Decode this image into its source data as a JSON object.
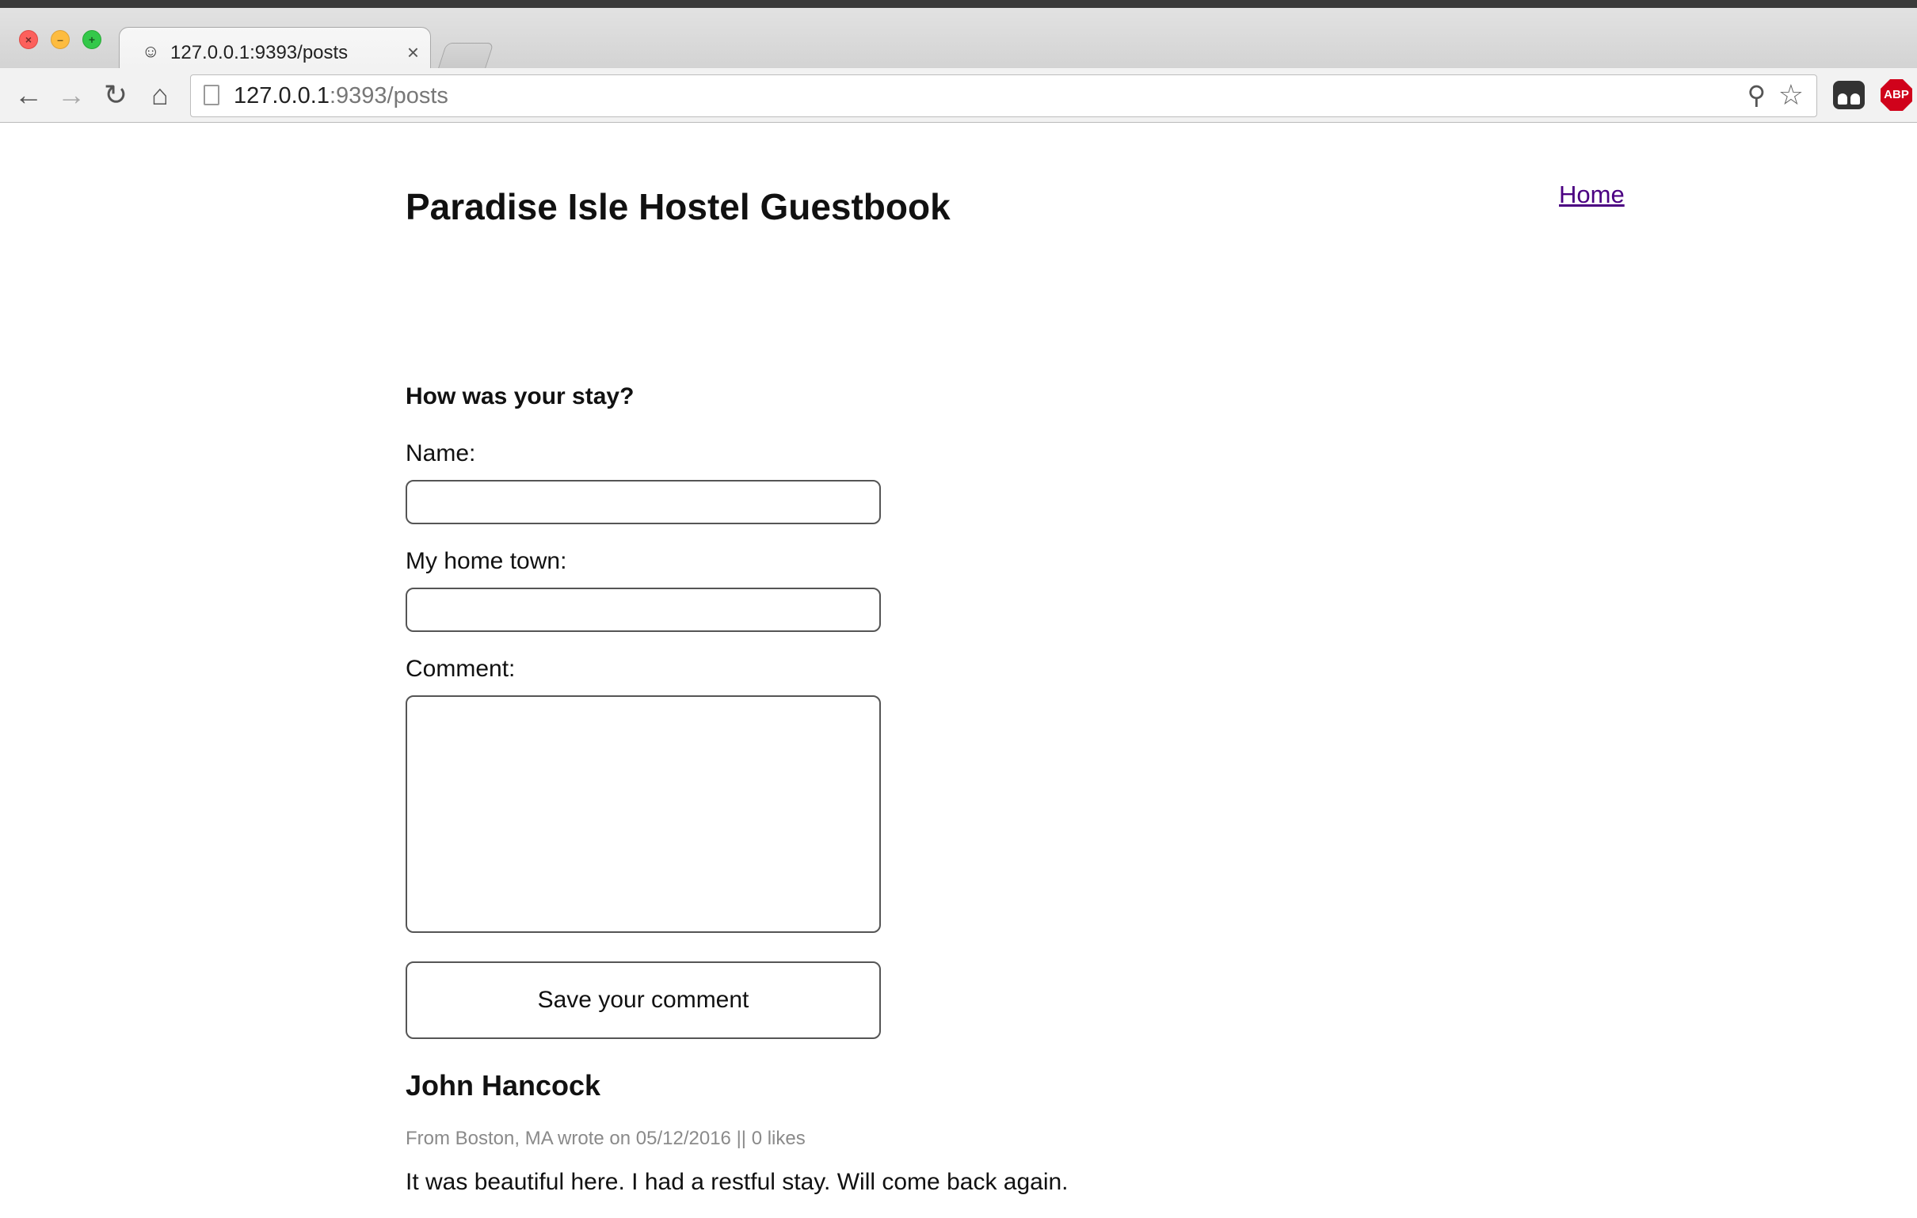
{
  "browser": {
    "tab_title": "127.0.0.1:9393/posts",
    "tab_close_glyph": "×",
    "url_host": "127.0.0.1",
    "url_path": ":9393/posts",
    "extensions": {
      "abp_label": "ABP"
    }
  },
  "page": {
    "title": "Paradise Isle Hostel Guestbook",
    "nav": {
      "home_label": "Home"
    },
    "form": {
      "heading": "How was your stay?",
      "name_label": "Name:",
      "name_value": "",
      "hometown_label": "My home town:",
      "hometown_value": "",
      "comment_label": "Comment:",
      "comment_value": "",
      "submit_label": "Save your comment"
    },
    "posts": [
      {
        "author": "John Hancock",
        "meta": "From Boston, MA wrote on 05/12/2016 || 0 likes",
        "body": "It was beautiful here. I had a restful stay. Will come back again."
      }
    ]
  },
  "icons": [
    "close-icon",
    "minimize-icon",
    "maximize-icon",
    "favicon-icon",
    "back-icon",
    "forward-icon",
    "reload-icon",
    "home-icon",
    "page-icon",
    "search-icon",
    "star-icon",
    "ghostery-icon",
    "adblock-icon"
  ],
  "colors": {
    "link_visited": "#4b0082",
    "meta_text": "#8a8a8a"
  }
}
